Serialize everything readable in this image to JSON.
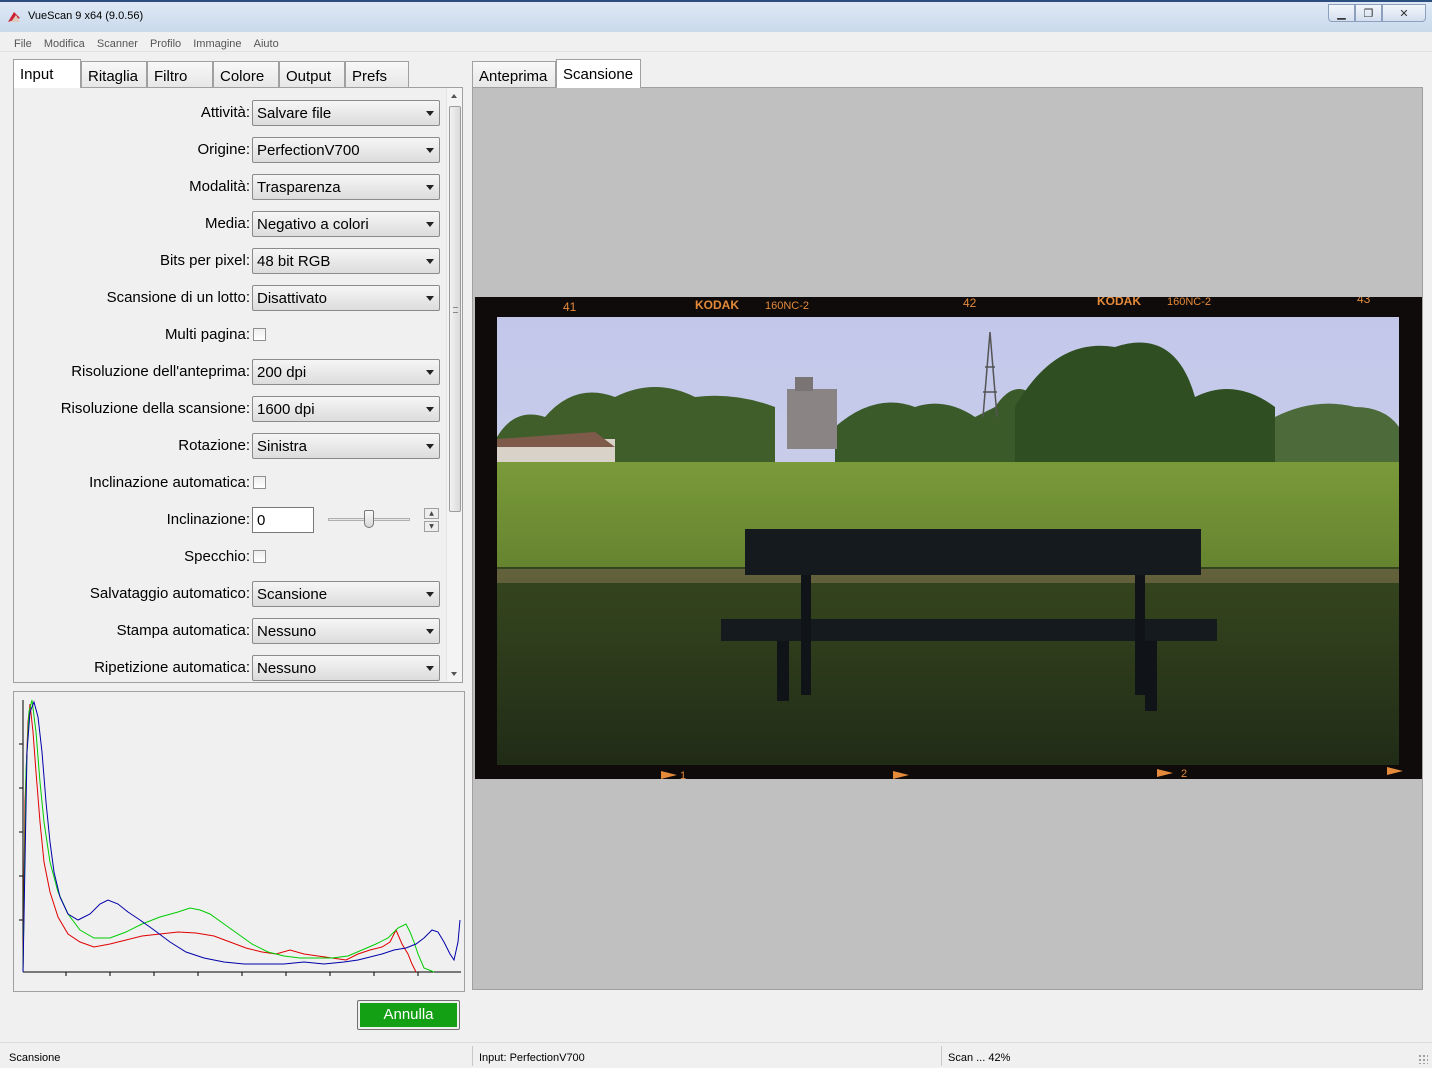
{
  "window": {
    "title": "VueScan 9 x64 (9.0.56)",
    "controls": {
      "minimize": "▁",
      "restore": "❐",
      "close": "✕"
    }
  },
  "menu": [
    "File",
    "Modifica",
    "Scanner",
    "Profilo",
    "Immagine",
    "Aiuto"
  ],
  "left_tabs": [
    "Input",
    "Ritaglia",
    "Filtro",
    "Colore",
    "Output",
    "Prefs"
  ],
  "left_tab_selected": "Input",
  "right_tabs": [
    "Anteprima",
    "Scansione"
  ],
  "right_tab_selected": "Scansione",
  "form": {
    "attivita": {
      "label": "Attività:",
      "value": "Salvare file"
    },
    "origine": {
      "label": "Origine:",
      "value": "PerfectionV700"
    },
    "modalita": {
      "label": "Modalità:",
      "value": "Trasparenza"
    },
    "media": {
      "label": "Media:",
      "value": "Negativo a colori"
    },
    "bits": {
      "label": "Bits per pixel:",
      "value": "48 bit RGB"
    },
    "lotto": {
      "label": "Scansione di un lotto:",
      "value": "Disattivato"
    },
    "multipagina": {
      "label": "Multi pagina:",
      "checked": false
    },
    "ris_anteprima": {
      "label": "Risoluzione dell'anteprima:",
      "value": "200 dpi"
    },
    "ris_scansione": {
      "label": "Risoluzione della scansione:",
      "value": "1600 dpi"
    },
    "rotazione": {
      "label": "Rotazione:",
      "value": "Sinistra"
    },
    "incl_auto": {
      "label": "Inclinazione automatica:",
      "checked": false
    },
    "inclinazione": {
      "label": "Inclinazione:",
      "value": "0"
    },
    "specchio": {
      "label": "Specchio:",
      "checked": false
    },
    "salv_auto": {
      "label": "Salvataggio automatico:",
      "value": "Scansione"
    },
    "stampa_auto": {
      "label": "Stampa automatica:",
      "value": "Nessuno"
    },
    "ripet_auto": {
      "label": "Ripetizione automatica:",
      "value": "Nessuno"
    }
  },
  "cancel_button": "Annulla",
  "film": {
    "frame_numbers": [
      "41",
      "42",
      "43"
    ],
    "brand": "KODAK",
    "stock": "160NC-2",
    "bottom_marks": [
      "1",
      "2"
    ]
  },
  "status": {
    "left": "Scansione",
    "middle": "Input: PerfectionV700",
    "right": "Scan ... 42%"
  },
  "colors": {
    "accent_button": "#14a014",
    "hist_red": "#e00000",
    "hist_green": "#00cc00",
    "hist_blue": "#0000aa",
    "preview_bg": "#c0c0c0"
  }
}
